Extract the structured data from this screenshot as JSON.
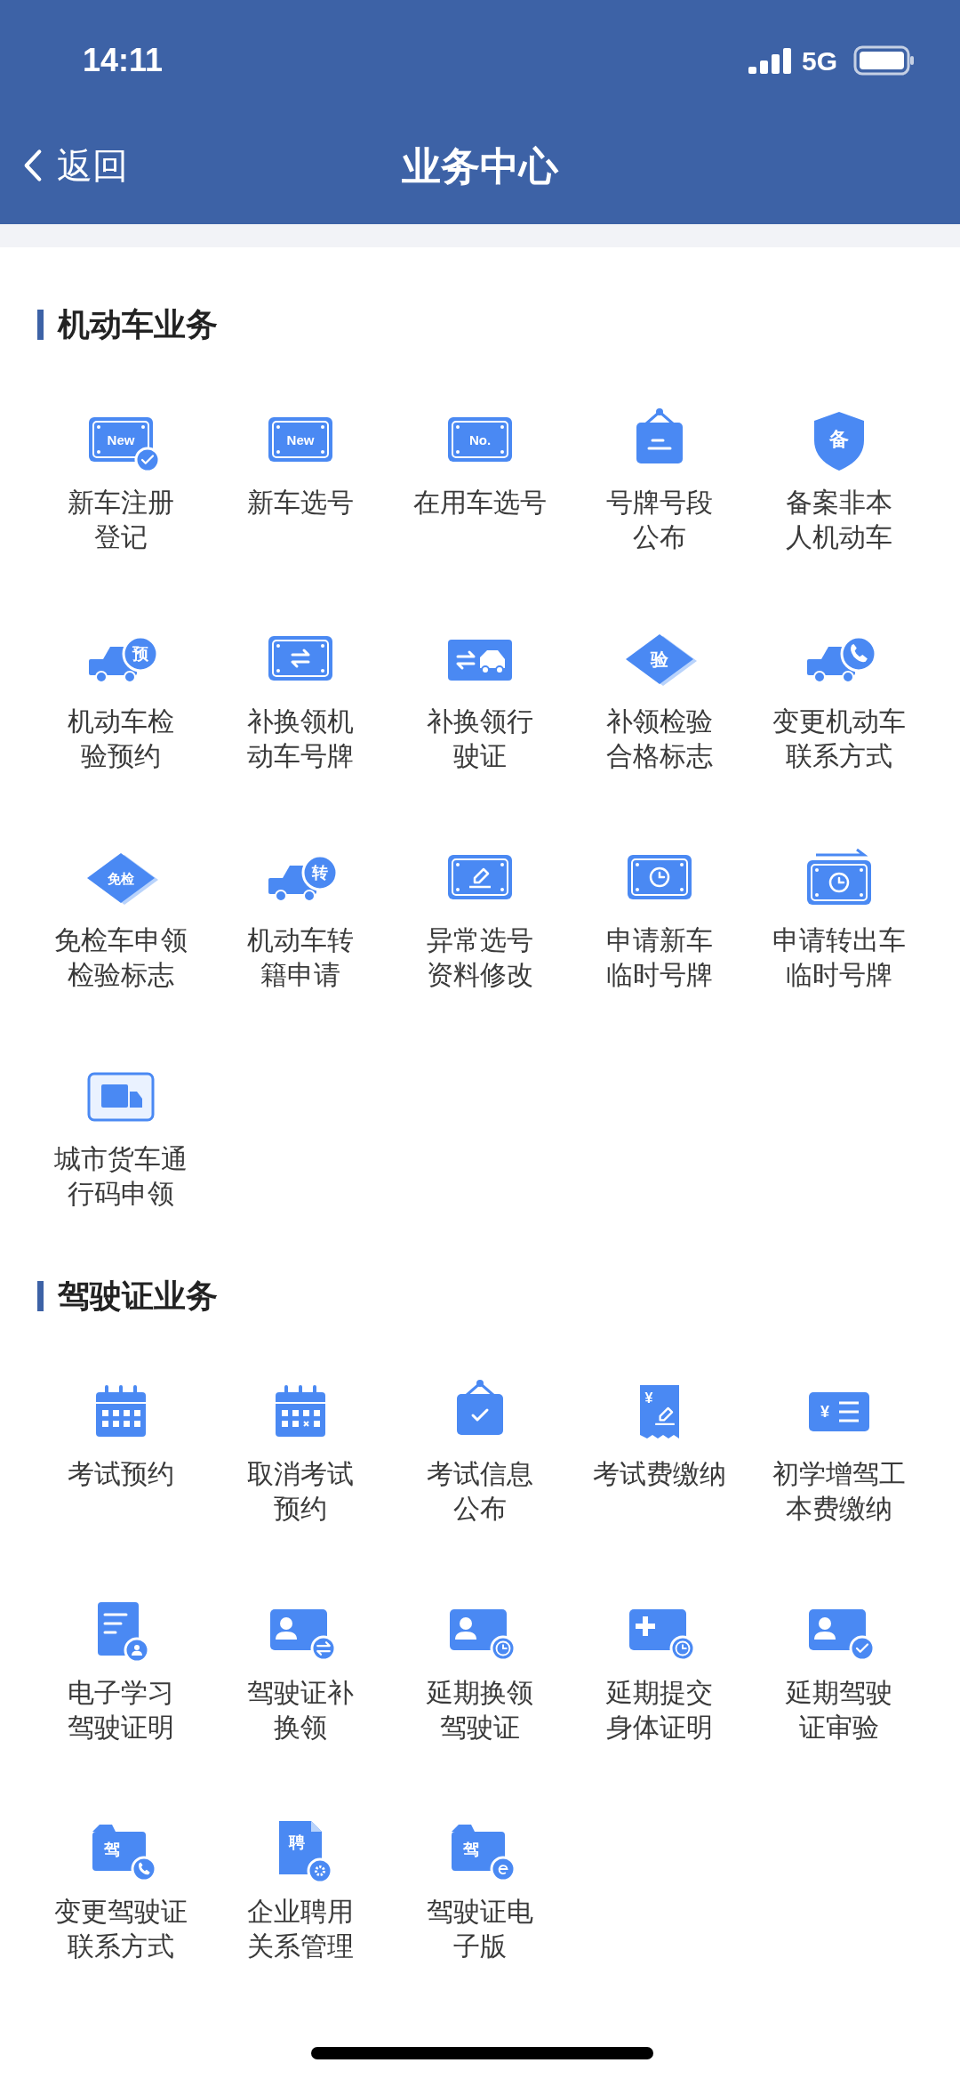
{
  "status_bar": {
    "time": "14:11",
    "network": "5G"
  },
  "nav": {
    "back": "返回",
    "title": "业务中心"
  },
  "sections": [
    {
      "title": "机动车业务",
      "items": [
        {
          "lines": [
            "新车注册",
            "登记"
          ],
          "glyph": "New"
        },
        {
          "lines": [
            "新车选号"
          ],
          "glyph": "New"
        },
        {
          "lines": [
            "在用车选号"
          ],
          "glyph": "No."
        },
        {
          "lines": [
            "号牌号段",
            "公布"
          ]
        },
        {
          "lines": [
            "备案非本",
            "人机动车"
          ],
          "glyph": "备"
        },
        {
          "lines": [
            "机动车检",
            "验预约"
          ],
          "glyph": "预"
        },
        {
          "lines": [
            "补换领机",
            "动车号牌"
          ]
        },
        {
          "lines": [
            "补换领行",
            "驶证"
          ]
        },
        {
          "lines": [
            "补领检验",
            "合格标志"
          ],
          "glyph": "验"
        },
        {
          "lines": [
            "变更机动车",
            "联系方式"
          ]
        },
        {
          "lines": [
            "免检车申领",
            "检验标志"
          ],
          "glyph": "免检"
        },
        {
          "lines": [
            "机动车转",
            "籍申请"
          ],
          "glyph": "转"
        },
        {
          "lines": [
            "异常选号",
            "资料修改"
          ]
        },
        {
          "lines": [
            "申请新车",
            "临时号牌"
          ]
        },
        {
          "lines": [
            "申请转出车",
            "临时号牌"
          ]
        },
        {
          "lines": [
            "城市货车通",
            "行码申领"
          ]
        }
      ]
    },
    {
      "title": "驾驶证业务",
      "items": [
        {
          "lines": [
            "考试预约"
          ]
        },
        {
          "lines": [
            "取消考试",
            "预约"
          ]
        },
        {
          "lines": [
            "考试信息",
            "公布"
          ]
        },
        {
          "lines": [
            "考试费缴纳"
          ],
          "glyph": "¥"
        },
        {
          "lines": [
            "初学增驾工",
            "本费缴纳"
          ],
          "glyph": "¥"
        },
        {
          "lines": [
            "电子学习",
            "驾驶证明"
          ]
        },
        {
          "lines": [
            "驾驶证补",
            "换领"
          ]
        },
        {
          "lines": [
            "延期换领",
            "驾驶证"
          ]
        },
        {
          "lines": [
            "延期提交",
            "身体证明"
          ]
        },
        {
          "lines": [
            "延期驾驶",
            "证审验"
          ]
        },
        {
          "lines": [
            "变更驾驶证",
            "联系方式"
          ],
          "glyph": "驾"
        },
        {
          "lines": [
            "企业聘用",
            "关系管理"
          ],
          "glyph": "聘"
        },
        {
          "lines": [
            "驾驶证电",
            "子版"
          ],
          "glyph": "驾"
        }
      ]
    }
  ]
}
